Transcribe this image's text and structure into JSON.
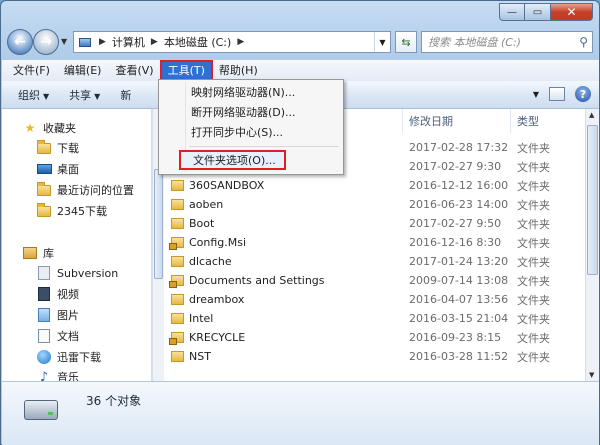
{
  "window": {
    "caption": {
      "min": "—",
      "max": "▭",
      "close": "✕"
    }
  },
  "address": {
    "segments": [
      "计算机",
      "本地磁盘 (C:)"
    ],
    "search_placeholder": "搜索 本地磁盘 (C:)"
  },
  "menubar": {
    "items": [
      "文件(F)",
      "编辑(E)",
      "查看(V)",
      "工具(T)",
      "帮助(H)"
    ],
    "active": "工具(T)"
  },
  "cmdbar": {
    "organize": "组织",
    "share": "共享",
    "new_partial": "新"
  },
  "tools_menu": {
    "items": [
      "映射网络驱动器(N)...",
      "断开网络驱动器(D)...",
      "打开同步中心(S)...",
      "文件夹选项(O)..."
    ],
    "highlighted": "文件夹选项(O)..."
  },
  "nav_tree": {
    "favorites": "收藏夹",
    "favorite_items": [
      "下载",
      "桌面",
      "最近访问的位置",
      "2345下载"
    ],
    "libraries": "库",
    "library_items": [
      "Subversion",
      "视频",
      "图片",
      "文档",
      "迅雷下载",
      "音乐"
    ]
  },
  "columns": {
    "date": "修改日期",
    "type": "类型"
  },
  "files": [
    {
      "name": "",
      "date": "2017-02-28 17:32",
      "type": "文件夹",
      "locked": false
    },
    {
      "name": "",
      "date": "2017-02-27 9:30",
      "type": "文件夹",
      "locked": false
    },
    {
      "name": "360SANDBOX",
      "date": "2016-12-12 16:00",
      "type": "文件夹",
      "locked": false
    },
    {
      "name": "aoben",
      "date": "2016-06-23 14:00",
      "type": "文件夹",
      "locked": false
    },
    {
      "name": "Boot",
      "date": "2017-02-27 9:50",
      "type": "文件夹",
      "locked": false
    },
    {
      "name": "Config.Msi",
      "date": "2016-12-16 8:30",
      "type": "文件夹",
      "locked": true
    },
    {
      "name": "dlcache",
      "date": "2017-01-24 13:20",
      "type": "文件夹",
      "locked": false
    },
    {
      "name": "Documents and Settings",
      "date": "2009-07-14 13:08",
      "type": "文件夹",
      "locked": true
    },
    {
      "name": "dreambox",
      "date": "2016-04-07 13:56",
      "type": "文件夹",
      "locked": false
    },
    {
      "name": "Intel",
      "date": "2016-03-15 21:04",
      "type": "文件夹",
      "locked": false
    },
    {
      "name": "KRECYCLE",
      "date": "2016-09-23 8:15",
      "type": "文件夹",
      "locked": true
    },
    {
      "name": "NST",
      "date": "2016-03-28 11:52",
      "type": "文件夹",
      "locked": false
    }
  ],
  "status": {
    "count": "36 个对象"
  }
}
